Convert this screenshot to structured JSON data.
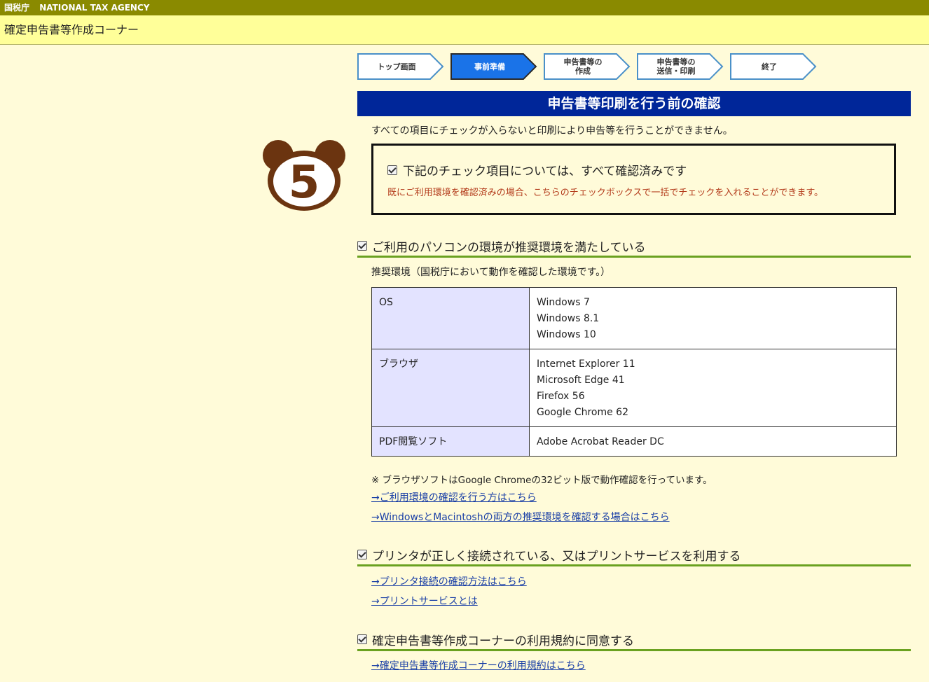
{
  "header": {
    "agency_jp": "国税庁",
    "agency_en": "NATIONAL TAX AGENCY",
    "app_title": "確定申告書等作成コーナー"
  },
  "steps": [
    {
      "label": "トップ画面",
      "active": false
    },
    {
      "label": "事前準備",
      "active": true
    },
    {
      "label": "申告書等の\n作成",
      "active": false
    },
    {
      "label": "申告書等の\n送信・印刷",
      "active": false
    },
    {
      "label": "終了",
      "active": false
    }
  ],
  "colors": {
    "step_active": "#1a73e8",
    "step_border": "#4a90c8",
    "header_blue": "#002699",
    "rule_green": "#6aa120"
  },
  "page": {
    "section_title": "申告書等印刷を行う前の確認",
    "notice": "すべての項目にチェックが入らないと印刷により申告等を行うことができません。",
    "mascot_number": "5",
    "confirm_all": {
      "label": "下記のチェック項目については、すべて確認済みです",
      "note": "既にご利用環境を確認済みの場合、こちらのチェックボックスで一括でチェックを入れることができます。",
      "checked": true
    }
  },
  "env_check": {
    "label": "ご利用のパソコンの環境が推奨環境を満たしている",
    "checked": true,
    "recommended_caption": "推奨環境（国税庁において動作を確認した環境です。）",
    "table": [
      {
        "key": "OS",
        "values": [
          "Windows 7",
          "Windows 8.1",
          "Windows 10"
        ]
      },
      {
        "key": "ブラウザ",
        "values": [
          "Internet Explorer 11",
          "Microsoft Edge 41",
          "Firefox 56",
          "Google Chrome 62"
        ]
      },
      {
        "key": "PDF閲覧ソフト",
        "values": [
          "Adobe Acrobat Reader DC"
        ]
      }
    ],
    "footnote": "※  ブラウザソフトはGoogle Chromeの32ビット版で動作確認を行っています。",
    "links": [
      "→ご利用環境の確認を行う方はこちら",
      "→WindowsとMacintoshの両方の推奨環境を確認する場合はこちら"
    ]
  },
  "printer_check": {
    "label": "プリンタが正しく接続されている、又はプリントサービスを利用する",
    "checked": true,
    "links": [
      "→プリンタ接続の確認方法はこちら",
      "→プリントサービスとは"
    ]
  },
  "terms_check": {
    "label": "確定申告書等作成コーナーの利用規約に同意する",
    "checked": true,
    "links": [
      "→確定申告書等作成コーナーの利用規約はこちら"
    ]
  }
}
